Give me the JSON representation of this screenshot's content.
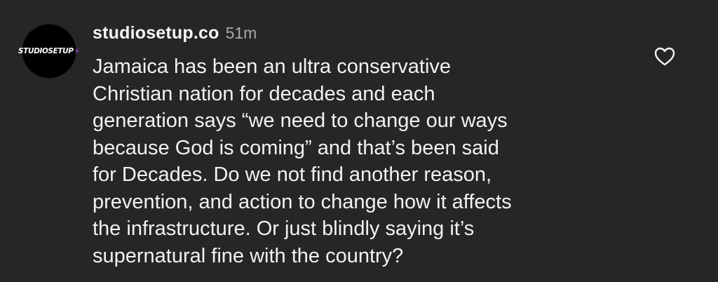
{
  "comment": {
    "avatar_text": "STUDIOSETUP",
    "username": "studiosetup.co",
    "timestamp": "51m",
    "lines": [
      "Jamaica has been an ultra conservative",
      "Christian nation for decades and each",
      "generation says “we need to change our ways",
      "because God is coming” and that’s been said",
      "for Decades. Do we not find another reason,",
      "prevention, and action to change how it affects",
      "the infrastructure. Or just blindly saying it’s",
      "supernatural fine with the country?"
    ],
    "like_icon": "heart-outline-icon"
  },
  "colors": {
    "background": "#262626",
    "text": "#f5f5f5",
    "muted": "#a8a8a8",
    "avatar_bolt": "#b44cff"
  }
}
